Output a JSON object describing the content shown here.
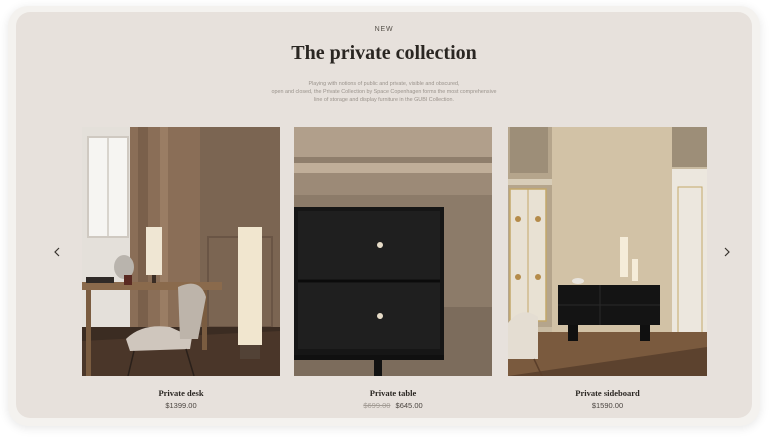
{
  "section": {
    "eyebrow": "NEW",
    "title": "The private collection",
    "description_lines": [
      "Playing with notions of public and private, visible and obscured,",
      "open and closed, the Private Collection by Space Copenhagen forms the most comprehensive",
      "line of storage and display furniture in the GUBI Collection."
    ]
  },
  "carousel": {
    "prev_icon": "chevron-left-icon",
    "next_icon": "chevron-right-icon",
    "products": [
      {
        "name": "Private desk",
        "price": "$1399.00",
        "old_price": ""
      },
      {
        "name": "Private table",
        "price": "$645.00",
        "old_price": "$699.00"
      },
      {
        "name": "Private sideboard",
        "price": "$1590.00",
        "old_price": ""
      }
    ]
  },
  "colors": {
    "frame": "#f4f2ef",
    "panel": "#e7e1dc",
    "heading": "#2a2622",
    "muted": "#9a938c"
  }
}
